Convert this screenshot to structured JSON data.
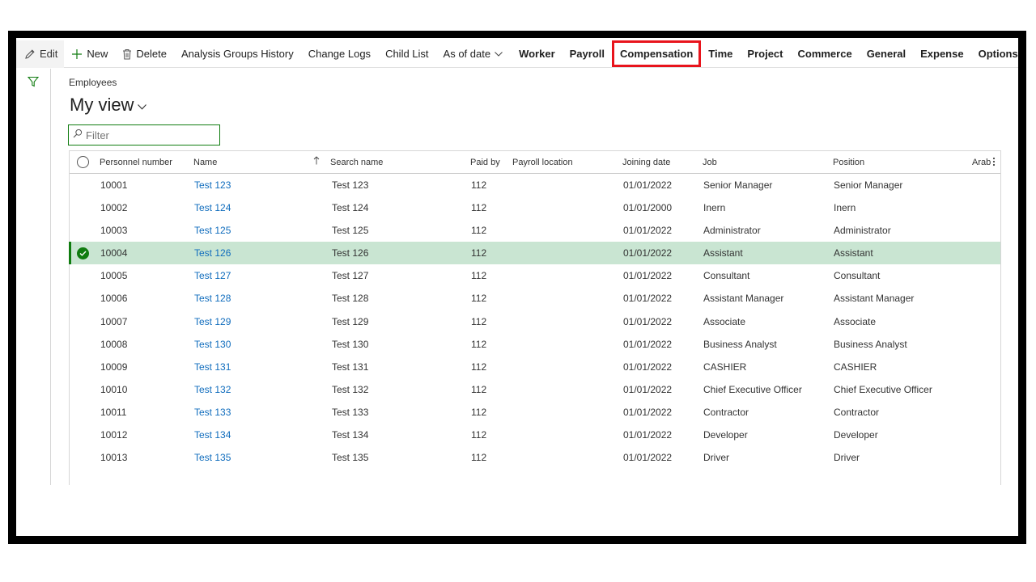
{
  "actionbar": {
    "edit": "Edit",
    "new": "New",
    "delete": "Delete",
    "analysis_groups_history": "Analysis Groups History",
    "change_logs": "Change Logs",
    "child_list": "Child List",
    "as_of_date": "As of date",
    "tabs": [
      "Worker",
      "Payroll",
      "Compensation",
      "Time",
      "Project",
      "Commerce",
      "General",
      "Expense",
      "Options"
    ]
  },
  "page": {
    "caption": "Employees",
    "view_name": "My view"
  },
  "filter": {
    "placeholder": "Filter",
    "value": ""
  },
  "grid": {
    "columns": [
      "Personnel number",
      "Name",
      "Search name",
      "Paid by",
      "Payroll location",
      "Joining date",
      "Job",
      "Position",
      "Arab"
    ],
    "sorted_column": "Name",
    "rows": [
      {
        "personnel_number": "10001",
        "name": "Test 123",
        "search_name": "Test 123",
        "paid_by": "112",
        "payroll_location": "",
        "joining_date": "01/01/2022",
        "job": "Senior Manager",
        "position": "Senior Manager"
      },
      {
        "personnel_number": "10002",
        "name": "Test 124",
        "search_name": "Test 124",
        "paid_by": "112",
        "payroll_location": "",
        "joining_date": "01/01/2000",
        "job": "Inern",
        "position": "Inern"
      },
      {
        "personnel_number": "10003",
        "name": "Test 125",
        "search_name": "Test 125",
        "paid_by": "112",
        "payroll_location": "",
        "joining_date": "01/01/2022",
        "job": "Administrator",
        "position": "Administrator"
      },
      {
        "personnel_number": "10004",
        "name": "Test 126",
        "search_name": "Test 126",
        "paid_by": "112",
        "payroll_location": "",
        "joining_date": "01/01/2022",
        "job": "Assistant",
        "position": "Assistant"
      },
      {
        "personnel_number": "10005",
        "name": "Test 127",
        "search_name": "Test 127",
        "paid_by": "112",
        "payroll_location": "",
        "joining_date": "01/01/2022",
        "job": "Consultant",
        "position": "Consultant"
      },
      {
        "personnel_number": "10006",
        "name": "Test 128",
        "search_name": "Test 128",
        "paid_by": "112",
        "payroll_location": "",
        "joining_date": "01/01/2022",
        "job": "Assistant Manager",
        "position": "Assistant Manager"
      },
      {
        "personnel_number": "10007",
        "name": "Test 129",
        "search_name": "Test 129",
        "paid_by": "112",
        "payroll_location": "",
        "joining_date": "01/01/2022",
        "job": "Associate",
        "position": "Associate"
      },
      {
        "personnel_number": "10008",
        "name": "Test 130",
        "search_name": "Test 130",
        "paid_by": "112",
        "payroll_location": "",
        "joining_date": "01/01/2022",
        "job": "Business Analyst",
        "position": "Business Analyst"
      },
      {
        "personnel_number": "10009",
        "name": "Test 131",
        "search_name": "Test 131",
        "paid_by": "112",
        "payroll_location": "",
        "joining_date": "01/01/2022",
        "job": "CASHIER",
        "position": "CASHIER"
      },
      {
        "personnel_number": "10010",
        "name": "Test 132",
        "search_name": "Test 132",
        "paid_by": "112",
        "payroll_location": "",
        "joining_date": "01/01/2022",
        "job": "Chief Executive Officer",
        "position": "Chief Executive Officer"
      },
      {
        "personnel_number": "10011",
        "name": "Test 133",
        "search_name": "Test 133",
        "paid_by": "112",
        "payroll_location": "",
        "joining_date": "01/01/2022",
        "job": "Contractor",
        "position": "Contractor"
      },
      {
        "personnel_number": "10012",
        "name": "Test 134",
        "search_name": "Test 134",
        "paid_by": "112",
        "payroll_location": "",
        "joining_date": "01/01/2022",
        "job": "Developer",
        "position": "Developer"
      },
      {
        "personnel_number": "10013",
        "name": "Test 135",
        "search_name": "Test 135",
        "paid_by": "112",
        "payroll_location": "",
        "joining_date": "01/01/2022",
        "job": "Driver",
        "position": "Driver"
      }
    ]
  },
  "colors": {
    "accent_green": "#107c10",
    "selected_row": "#c9e5d2",
    "link_blue": "#0f6cbd",
    "highlight_red": "#e8141c"
  }
}
